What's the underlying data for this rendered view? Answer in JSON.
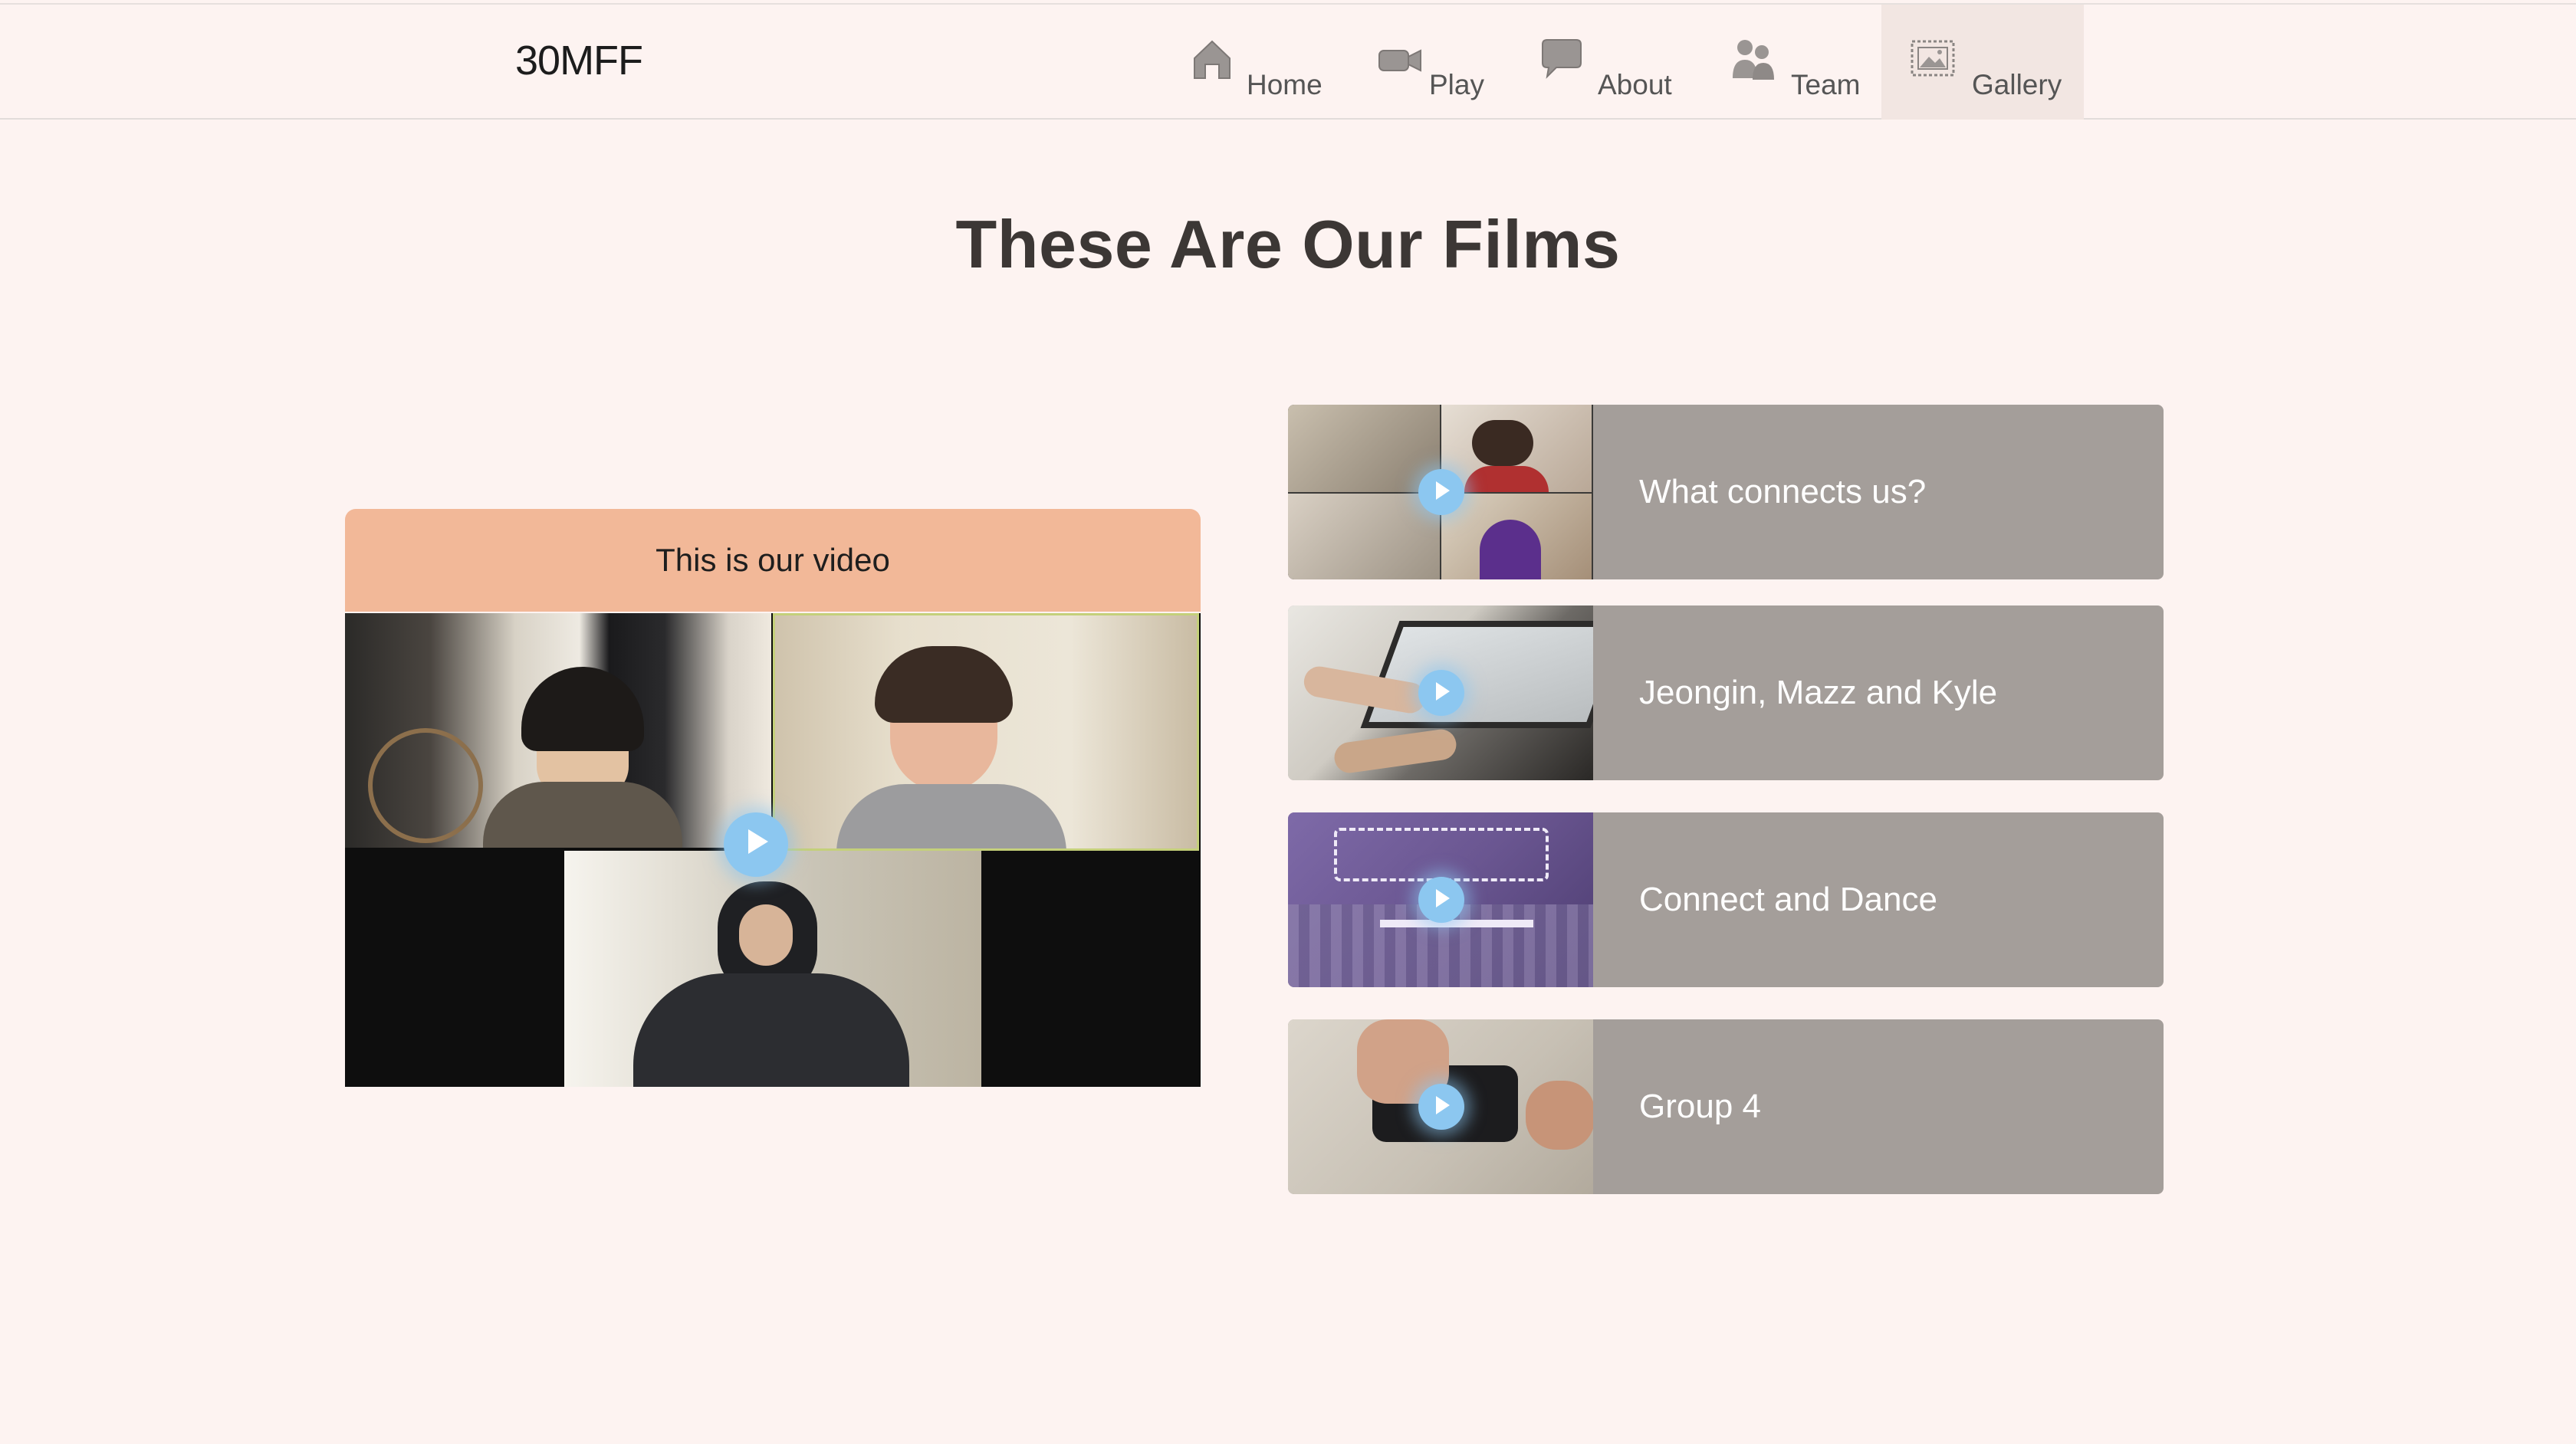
{
  "header": {
    "brand": "30MFF",
    "nav": [
      {
        "label": "Home",
        "icon": "home-icon"
      },
      {
        "label": "Play",
        "icon": "camera-icon"
      },
      {
        "label": "About",
        "icon": "chat-bubble-icon"
      },
      {
        "label": "Team",
        "icon": "people-icon"
      },
      {
        "label": "Gallery",
        "icon": "picture-frame-icon",
        "active": true
      }
    ]
  },
  "main": {
    "title": "These Are Our Films",
    "featured": {
      "label": "This is our video"
    },
    "films": [
      {
        "title": "What connects us?"
      },
      {
        "title": "Jeongin, Mazz and Kyle"
      },
      {
        "title": "Connect and Dance"
      },
      {
        "title": "Group 4"
      }
    ]
  },
  "colors": {
    "background": "#fdf3f1",
    "featured_header": "#f2b898",
    "card": "#a49e9a",
    "play_button": "#8cc7f0"
  }
}
